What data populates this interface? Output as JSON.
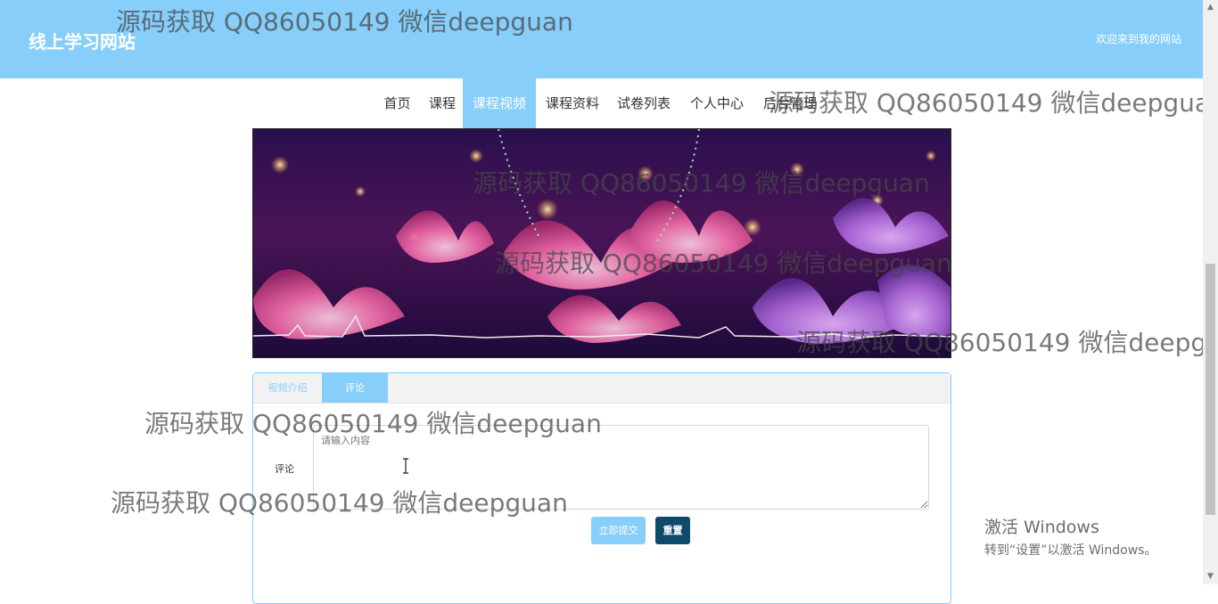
{
  "header": {
    "site_title": "线上学习网站",
    "welcome": "欢迎来到我的网站"
  },
  "nav": {
    "items": [
      "首页",
      "课程",
      "课程视频",
      "课程资料",
      "试卷列表",
      "个人中心",
      "后台管理"
    ],
    "active": "课程视频"
  },
  "tabs": {
    "intro": "视频介绍",
    "comment": "评论"
  },
  "form": {
    "comment_label": "评论",
    "placeholder": "请输入内容",
    "submit": "立即提交",
    "reset": "重置"
  },
  "watermark": "源码获取 QQ86050149 微信deepguan",
  "activation": {
    "line1": "激活 Windows",
    "line2": "转到“设置”以激活 Windows。"
  },
  "colors": {
    "accent": "#87cefa",
    "reset_button": "#0f4a6a"
  }
}
